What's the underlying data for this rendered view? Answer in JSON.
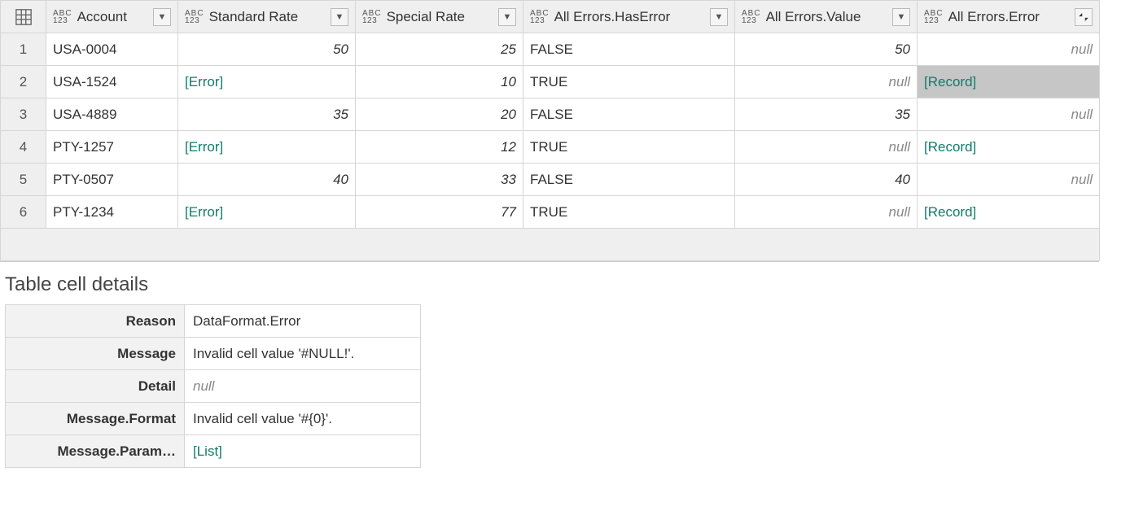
{
  "grid": {
    "columns": [
      {
        "name": "Account"
      },
      {
        "name": "Standard Rate"
      },
      {
        "name": "Special Rate"
      },
      {
        "name": "All Errors.HasError"
      },
      {
        "name": "All Errors.Value"
      },
      {
        "name": "All Errors.Error"
      }
    ],
    "rows": [
      {
        "num": "1",
        "account": "USA-0004",
        "standard_rate": {
          "text": "50",
          "kind": "num"
        },
        "special_rate": {
          "text": "25",
          "kind": "num"
        },
        "has_error": "FALSE",
        "value": {
          "text": "50",
          "kind": "num"
        },
        "error": {
          "text": "null",
          "kind": "null"
        },
        "selected": false
      },
      {
        "num": "2",
        "account": "USA-1524",
        "standard_rate": {
          "text": "[Error]",
          "kind": "link"
        },
        "special_rate": {
          "text": "10",
          "kind": "num"
        },
        "has_error": "TRUE",
        "value": {
          "text": "null",
          "kind": "null-right"
        },
        "error": {
          "text": "[Record]",
          "kind": "link"
        },
        "selected": true
      },
      {
        "num": "3",
        "account": "USA-4889",
        "standard_rate": {
          "text": "35",
          "kind": "num"
        },
        "special_rate": {
          "text": "20",
          "kind": "num"
        },
        "has_error": "FALSE",
        "value": {
          "text": "35",
          "kind": "num"
        },
        "error": {
          "text": "null",
          "kind": "null"
        },
        "selected": false
      },
      {
        "num": "4",
        "account": "PTY-1257",
        "standard_rate": {
          "text": "[Error]",
          "kind": "link"
        },
        "special_rate": {
          "text": "12",
          "kind": "num"
        },
        "has_error": "TRUE",
        "value": {
          "text": "null",
          "kind": "null-right"
        },
        "error": {
          "text": "[Record]",
          "kind": "link"
        },
        "selected": false
      },
      {
        "num": "5",
        "account": "PTY-0507",
        "standard_rate": {
          "text": "40",
          "kind": "num"
        },
        "special_rate": {
          "text": "33",
          "kind": "num"
        },
        "has_error": "FALSE",
        "value": {
          "text": "40",
          "kind": "num"
        },
        "error": {
          "text": "null",
          "kind": "null"
        },
        "selected": false
      },
      {
        "num": "6",
        "account": "PTY-1234",
        "standard_rate": {
          "text": "[Error]",
          "kind": "link"
        },
        "special_rate": {
          "text": "77",
          "kind": "num"
        },
        "has_error": "TRUE",
        "value": {
          "text": "null",
          "kind": "null-right"
        },
        "error": {
          "text": "[Record]",
          "kind": "link"
        },
        "selected": false
      }
    ]
  },
  "details": {
    "title": "Table cell details",
    "rows": [
      {
        "key": "Reason",
        "val": {
          "text": "DataFormat.Error",
          "kind": "text"
        }
      },
      {
        "key": "Message",
        "val": {
          "text": "Invalid cell value '#NULL!'.",
          "kind": "text"
        }
      },
      {
        "key": "Detail",
        "val": {
          "text": "null",
          "kind": "null"
        }
      },
      {
        "key": "Message.Format",
        "val": {
          "text": "Invalid cell value '#{0}'.",
          "kind": "text"
        }
      },
      {
        "key": "Message.Param…",
        "val": {
          "text": "[List]",
          "kind": "link"
        }
      }
    ]
  }
}
